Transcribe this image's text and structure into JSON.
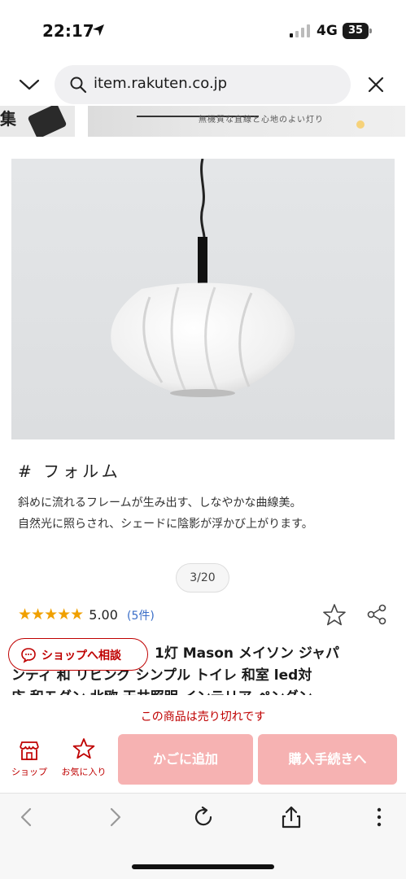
{
  "status_bar": {
    "time": "22:17",
    "network": "4G",
    "battery": "35"
  },
  "browser": {
    "url": "item.rakuten.co.jp"
  },
  "banner": {
    "left_text": "集",
    "tagline": "無機質な直線と心地のよい灯り"
  },
  "content": {
    "heading": "# フォルム",
    "description_line1": "斜めに流れるフレームが生み出す、しなやかな曲線美。",
    "description_line2": "自然光に照らされ、シェードに陰影が浮かび上がります。",
    "image_counter": "3/20"
  },
  "product": {
    "stars": "★★★★★",
    "rating": "5.00",
    "review_count": "(5件)",
    "consult_label": "ショップへ相談",
    "title_line1": "1灯 Mason メイソン ジャパ",
    "title_line2": "ンディ 和 リビング シンプル トイレ 和室 led対",
    "title_line3": "応 和モダン 北欧 天井照明 インテリア ペンダン"
  },
  "purchase": {
    "sold_out": "この商品は売り切れです",
    "shop_label": "ショップ",
    "favorite_label": "お気に入り",
    "cart_label": "かごに追加",
    "buy_label": "購入手続きへ"
  },
  "colors": {
    "brand": "#bf0000",
    "disabled_button": "#f6b2b2",
    "star": "#f0a000",
    "link": "#3a6ec8"
  },
  "icons": [
    "location-arrow-icon",
    "signal-icon",
    "battery-icon",
    "chevron-down-icon",
    "search-icon",
    "close-icon",
    "star-outline-icon",
    "share-icon",
    "chat-icon",
    "shop-icon",
    "heart-star-icon",
    "back-icon",
    "forward-icon",
    "reload-icon",
    "share-upload-icon",
    "more-icon"
  ]
}
